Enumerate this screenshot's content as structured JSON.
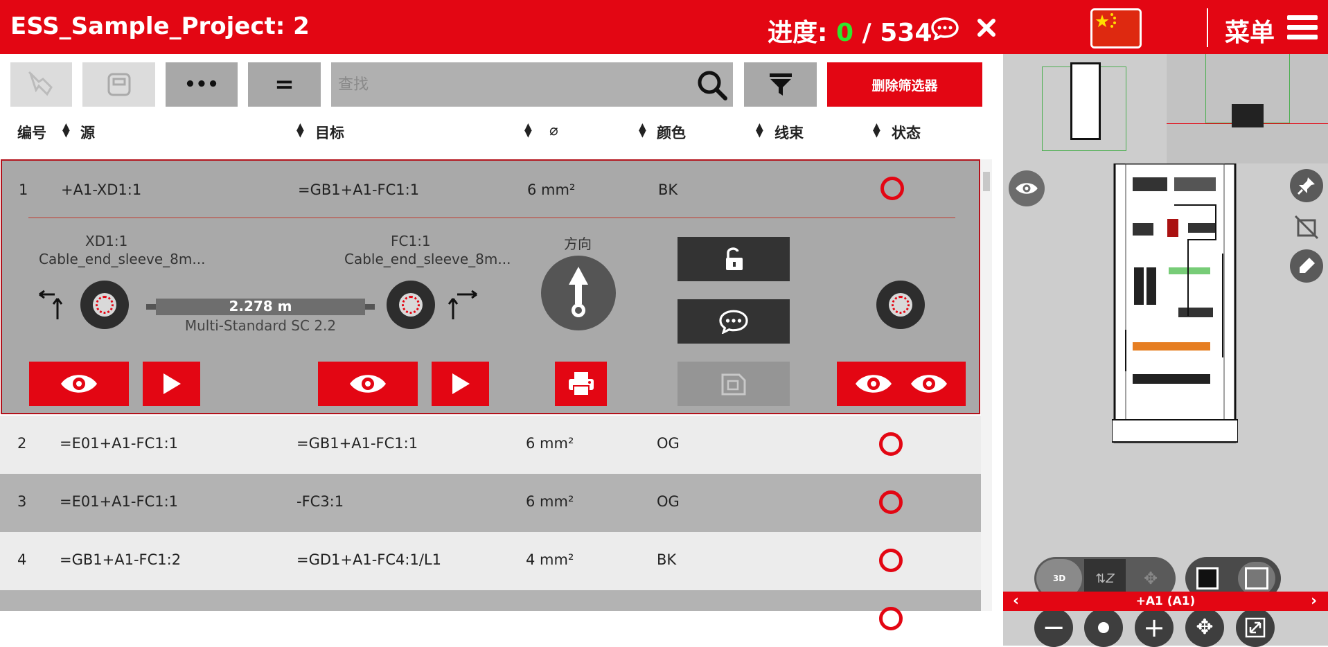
{
  "header": {
    "project_title": "ESS_Sample_Project: 2",
    "progress_label": "进度:",
    "progress_done": "0",
    "progress_sep": "/",
    "progress_total": "534",
    "menu_label": "菜单"
  },
  "toolbar": {
    "search_placeholder": "查找",
    "more_label": "•••",
    "equals_label": "=",
    "clear_filter_label": "删除筛选器"
  },
  "columns": {
    "number": "编号",
    "source": "源",
    "target": "目标",
    "diameter": "⌀",
    "color": "颜色",
    "bundle": "线束",
    "status": "状态"
  },
  "rows": [
    {
      "no": "1",
      "source": "+A1-XD1:1",
      "target": "=GB1+A1-FC1:1",
      "diameter": "6 mm²",
      "color": "BK"
    },
    {
      "no": "2",
      "source": "=E01+A1-FC1:1",
      "target": "=GB1+A1-FC1:1",
      "diameter": "6 mm²",
      "color": "OG"
    },
    {
      "no": "3",
      "source": "=E01+A1-FC1:1",
      "target": "-FC3:1",
      "diameter": "6 mm²",
      "color": "OG"
    },
    {
      "no": "4",
      "source": "=GB1+A1-FC1:2",
      "target": "=GD1+A1-FC4:1/L1",
      "diameter": "4 mm²",
      "color": "BK"
    }
  ],
  "detail": {
    "source_id": "XD1:1",
    "source_end": "Cable_end_sleeve_8m...",
    "target_id": "FC1:1",
    "target_end": "Cable_end_sleeve_8m...",
    "length": "2.278 m",
    "wire_type": "Multi-Standard SC 2.2",
    "direction_label": "方向"
  },
  "viewer": {
    "nav_label": "+A1 (A1)"
  },
  "colors": {
    "brand_red": "#e30613",
    "progress_green": "#2ee62e"
  }
}
